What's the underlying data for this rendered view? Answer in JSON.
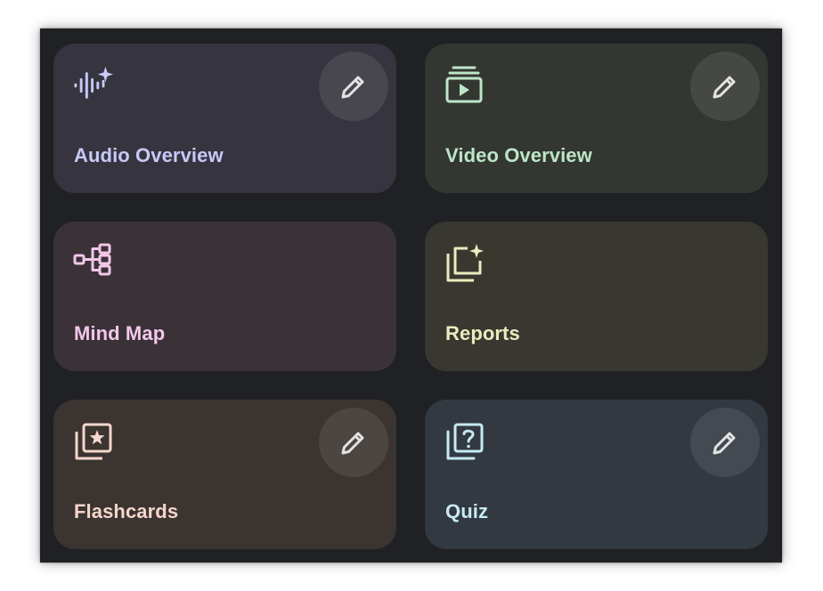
{
  "cards": [
    {
      "label": "Audio Overview",
      "icon": "audio-waveform-sparkle-icon",
      "has_edit": true,
      "bg": "#36353f",
      "fg": "#c7c9f7"
    },
    {
      "label": "Video Overview",
      "icon": "video-slides-icon",
      "has_edit": true,
      "bg": "#333631",
      "fg": "#bde6c9"
    },
    {
      "label": "Mind Map",
      "icon": "mind-map-icon",
      "has_edit": false,
      "bg": "#3a3237",
      "fg": "#f2c7ea"
    },
    {
      "label": "Reports",
      "icon": "report-sparkle-icon",
      "has_edit": false,
      "bg": "#393830",
      "fg": "#ecebbd"
    },
    {
      "label": "Flashcards",
      "icon": "flashcards-star-icon",
      "has_edit": true,
      "bg": "#3b3430",
      "fg": "#f5d6cc"
    },
    {
      "label": "Quiz",
      "icon": "quiz-question-icon",
      "has_edit": true,
      "bg": "#323941",
      "fg": "#c7e9f2"
    }
  ],
  "edit_icon": "pencil-icon",
  "colors": {
    "panel_bg": "#202124",
    "edit_button_bg": "rgba(255,255,255,0.09)",
    "edit_icon": "#e3e3e3"
  }
}
